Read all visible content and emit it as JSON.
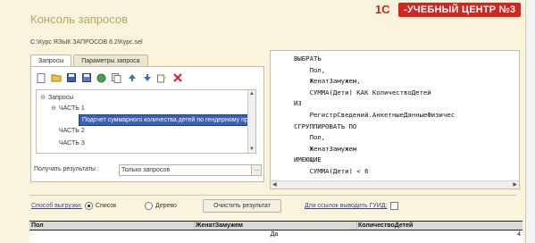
{
  "window": {
    "title": "Консоль запросов",
    "file_path": "C:\\Курс ЯЗЫК ЗАПРОСОВ 8.2\\Курс.sel"
  },
  "brand": {
    "logo": "1С",
    "text": "-УЧЕБНЫЙ ЦЕНТР №3"
  },
  "tabs": [
    {
      "label": "Запросы",
      "active": true
    },
    {
      "label": "Параметры запроса",
      "active": false
    }
  ],
  "toolbar": {
    "icons": [
      "new-document",
      "open-folder",
      "save",
      "save-as",
      "refresh",
      "copy",
      "move-up",
      "move-down",
      "edit-wizard",
      "delete"
    ]
  },
  "tree": {
    "items": [
      {
        "label": "Запросы",
        "level": 0,
        "toggle": "⊖"
      },
      {
        "label": "ЧАСТЬ 1",
        "level": 1,
        "toggle": "⊖"
      },
      {
        "label": "Подсчет суммарного количества детей по гендерному признаку",
        "level": 2,
        "selected": true
      },
      {
        "label": "ЧАСТЬ 2",
        "level": 1,
        "toggle": ""
      },
      {
        "label": "ЧАСТЬ 3",
        "level": 1,
        "toggle": ""
      }
    ]
  },
  "results": {
    "label": "Получать результаты :",
    "value": "Только запросов",
    "button": "..."
  },
  "code": {
    "lines": [
      "ВЫБРАТЬ",
      "    Пол,",
      "    ЖенатЗамужем,",
      "    СУММА(Дети) КАК КоличествоДетей",
      "ИЗ",
      "    РегистрСведений.АнкетныеДанныеФизичес",
      "СГРУППИРОВАТЬ ПО",
      "    Пол,",
      "    ЖенатЗамужем",
      "ИМЕЮЩИЕ",
      "    СУММА(Дети) < 6"
    ]
  },
  "options": {
    "unload_label": "Способ выгрузки:",
    "radio_list": "Список",
    "radio_tree": "Дерево",
    "clear_button": "Очистить результат",
    "guid_label": "Для ссылок выводить ГУИД:"
  },
  "table": {
    "headers": [
      "Пол",
      "ЖенатЗамужем",
      "КоличествоДетей"
    ],
    "rows": [
      [
        "",
        "Да",
        "4"
      ]
    ]
  },
  "colors": {
    "window_bg": "#fbf4dc",
    "brand_red": "#d32420",
    "selection": "#3a5fb8"
  }
}
